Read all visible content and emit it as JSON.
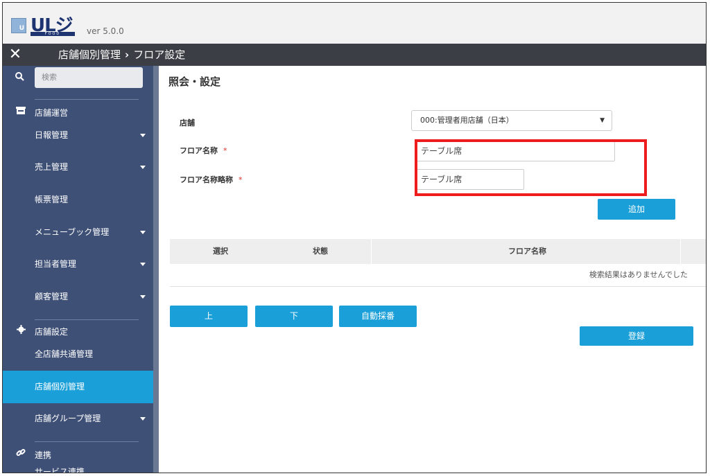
{
  "app": {
    "logo_text": "ULジ",
    "logo_sub": "FOOD",
    "logo_badge": "U",
    "version": "ver 5.0.0"
  },
  "breadcrumb": {
    "parent": "店舗個別管理",
    "separator": "›",
    "current": "フロア設定"
  },
  "sidebar": {
    "search_placeholder": "検索",
    "sections": [
      {
        "icon": "store-icon",
        "label": "店舗運営",
        "items": [
          {
            "label": "日報管理",
            "expandable": true
          },
          {
            "label": "売上管理",
            "expandable": true
          },
          {
            "label": "帳票管理",
            "expandable": false
          },
          {
            "label": "メニューブック管理",
            "expandable": true
          },
          {
            "label": "担当者管理",
            "expandable": true
          },
          {
            "label": "顧客管理",
            "expandable": true
          }
        ]
      },
      {
        "icon": "gear-icon",
        "label": "店舗設定",
        "items": [
          {
            "label": "全店舗共通管理",
            "expandable": false
          },
          {
            "label": "店舗個別管理",
            "expandable": false,
            "active": true
          },
          {
            "label": "店舗グループ管理",
            "expandable": true
          }
        ]
      },
      {
        "icon": "link-icon",
        "label": "連携",
        "items": [
          {
            "label": "サービス連携",
            "expandable": false
          }
        ]
      }
    ]
  },
  "main": {
    "title": "照会・設定",
    "form": {
      "store_label": "店舗",
      "store_value": "000:管理者用店舗（日本）",
      "floor_name_label": "フロア名称",
      "floor_name_value": "テーブル席",
      "floor_short_label": "フロア名称略称",
      "floor_short_value": "テーブル席",
      "required_mark": "*"
    },
    "add_button": "追加",
    "table": {
      "columns": [
        "選択",
        "状態",
        "フロア名称"
      ],
      "empty_message": "検索結果はありませんでした"
    },
    "up_button": "上",
    "down_button": "下",
    "auto_number_button": "自動採番",
    "register_button": "登録"
  },
  "colors": {
    "accent": "#1a9fd8",
    "sidebar": "#3f5077",
    "header_dark": "#3b3e45",
    "highlight": "#ee1c1c"
  }
}
